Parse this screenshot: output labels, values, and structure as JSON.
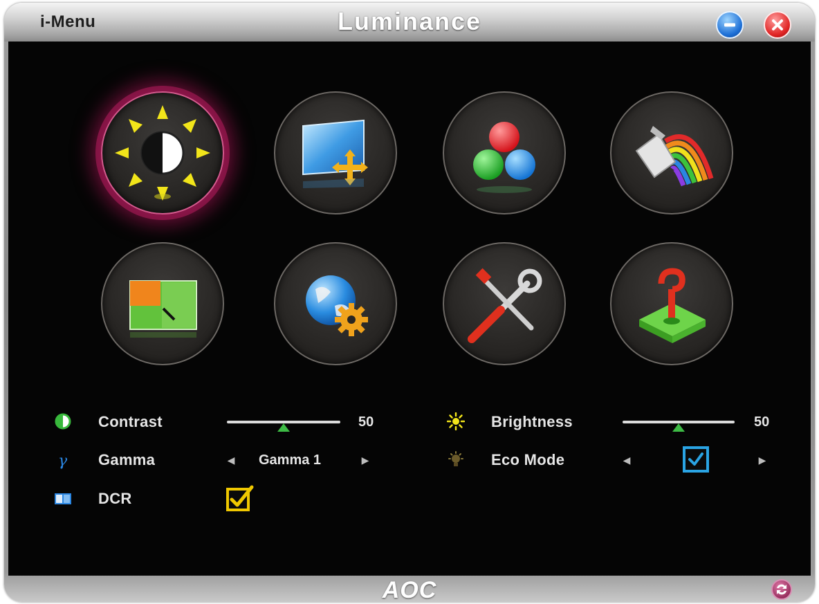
{
  "header": {
    "app_name": "i-Menu",
    "title": "Luminance"
  },
  "window_controls": {
    "minimize": "minimize-icon",
    "close": "close-icon"
  },
  "categories": [
    {
      "icon": "luminance-sun-contrast-icon",
      "active": true
    },
    {
      "icon": "image-setup-icon",
      "active": false
    },
    {
      "icon": "color-temp-rgb-balls-icon",
      "active": false
    },
    {
      "icon": "color-boost-rainbow-icon",
      "active": false
    },
    {
      "icon": "picture-boost-icon",
      "active": false
    },
    {
      "icon": "osd-setup-globe-gear-icon",
      "active": false
    },
    {
      "icon": "extra-tools-icon",
      "active": false
    },
    {
      "icon": "factory-reset-joystick-icon",
      "active": false
    }
  ],
  "settings": {
    "contrast": {
      "label": "Contrast",
      "value": "50",
      "level": 0.5,
      "icon": "contrast-half-circle-icon"
    },
    "brightness": {
      "label": "Brightness",
      "value": "50",
      "level": 0.5,
      "icon": "brightness-sun-icon"
    },
    "gamma": {
      "label": "Gamma",
      "value": "Gamma 1",
      "icon": "gamma-icon"
    },
    "eco_mode": {
      "label": "Eco Mode",
      "checked": true,
      "icon": "eco-bulb-icon"
    },
    "dcr": {
      "label": "DCR",
      "checked": true,
      "icon": "dcr-icon"
    }
  },
  "footer": {
    "logo": "AOC"
  },
  "colors": {
    "accent_active_ring": "#b71e5f",
    "slider_thumb": "#3dbb45",
    "checkbox_yellow": "#f0c800",
    "checkbox_blue": "#2aa4e4"
  }
}
